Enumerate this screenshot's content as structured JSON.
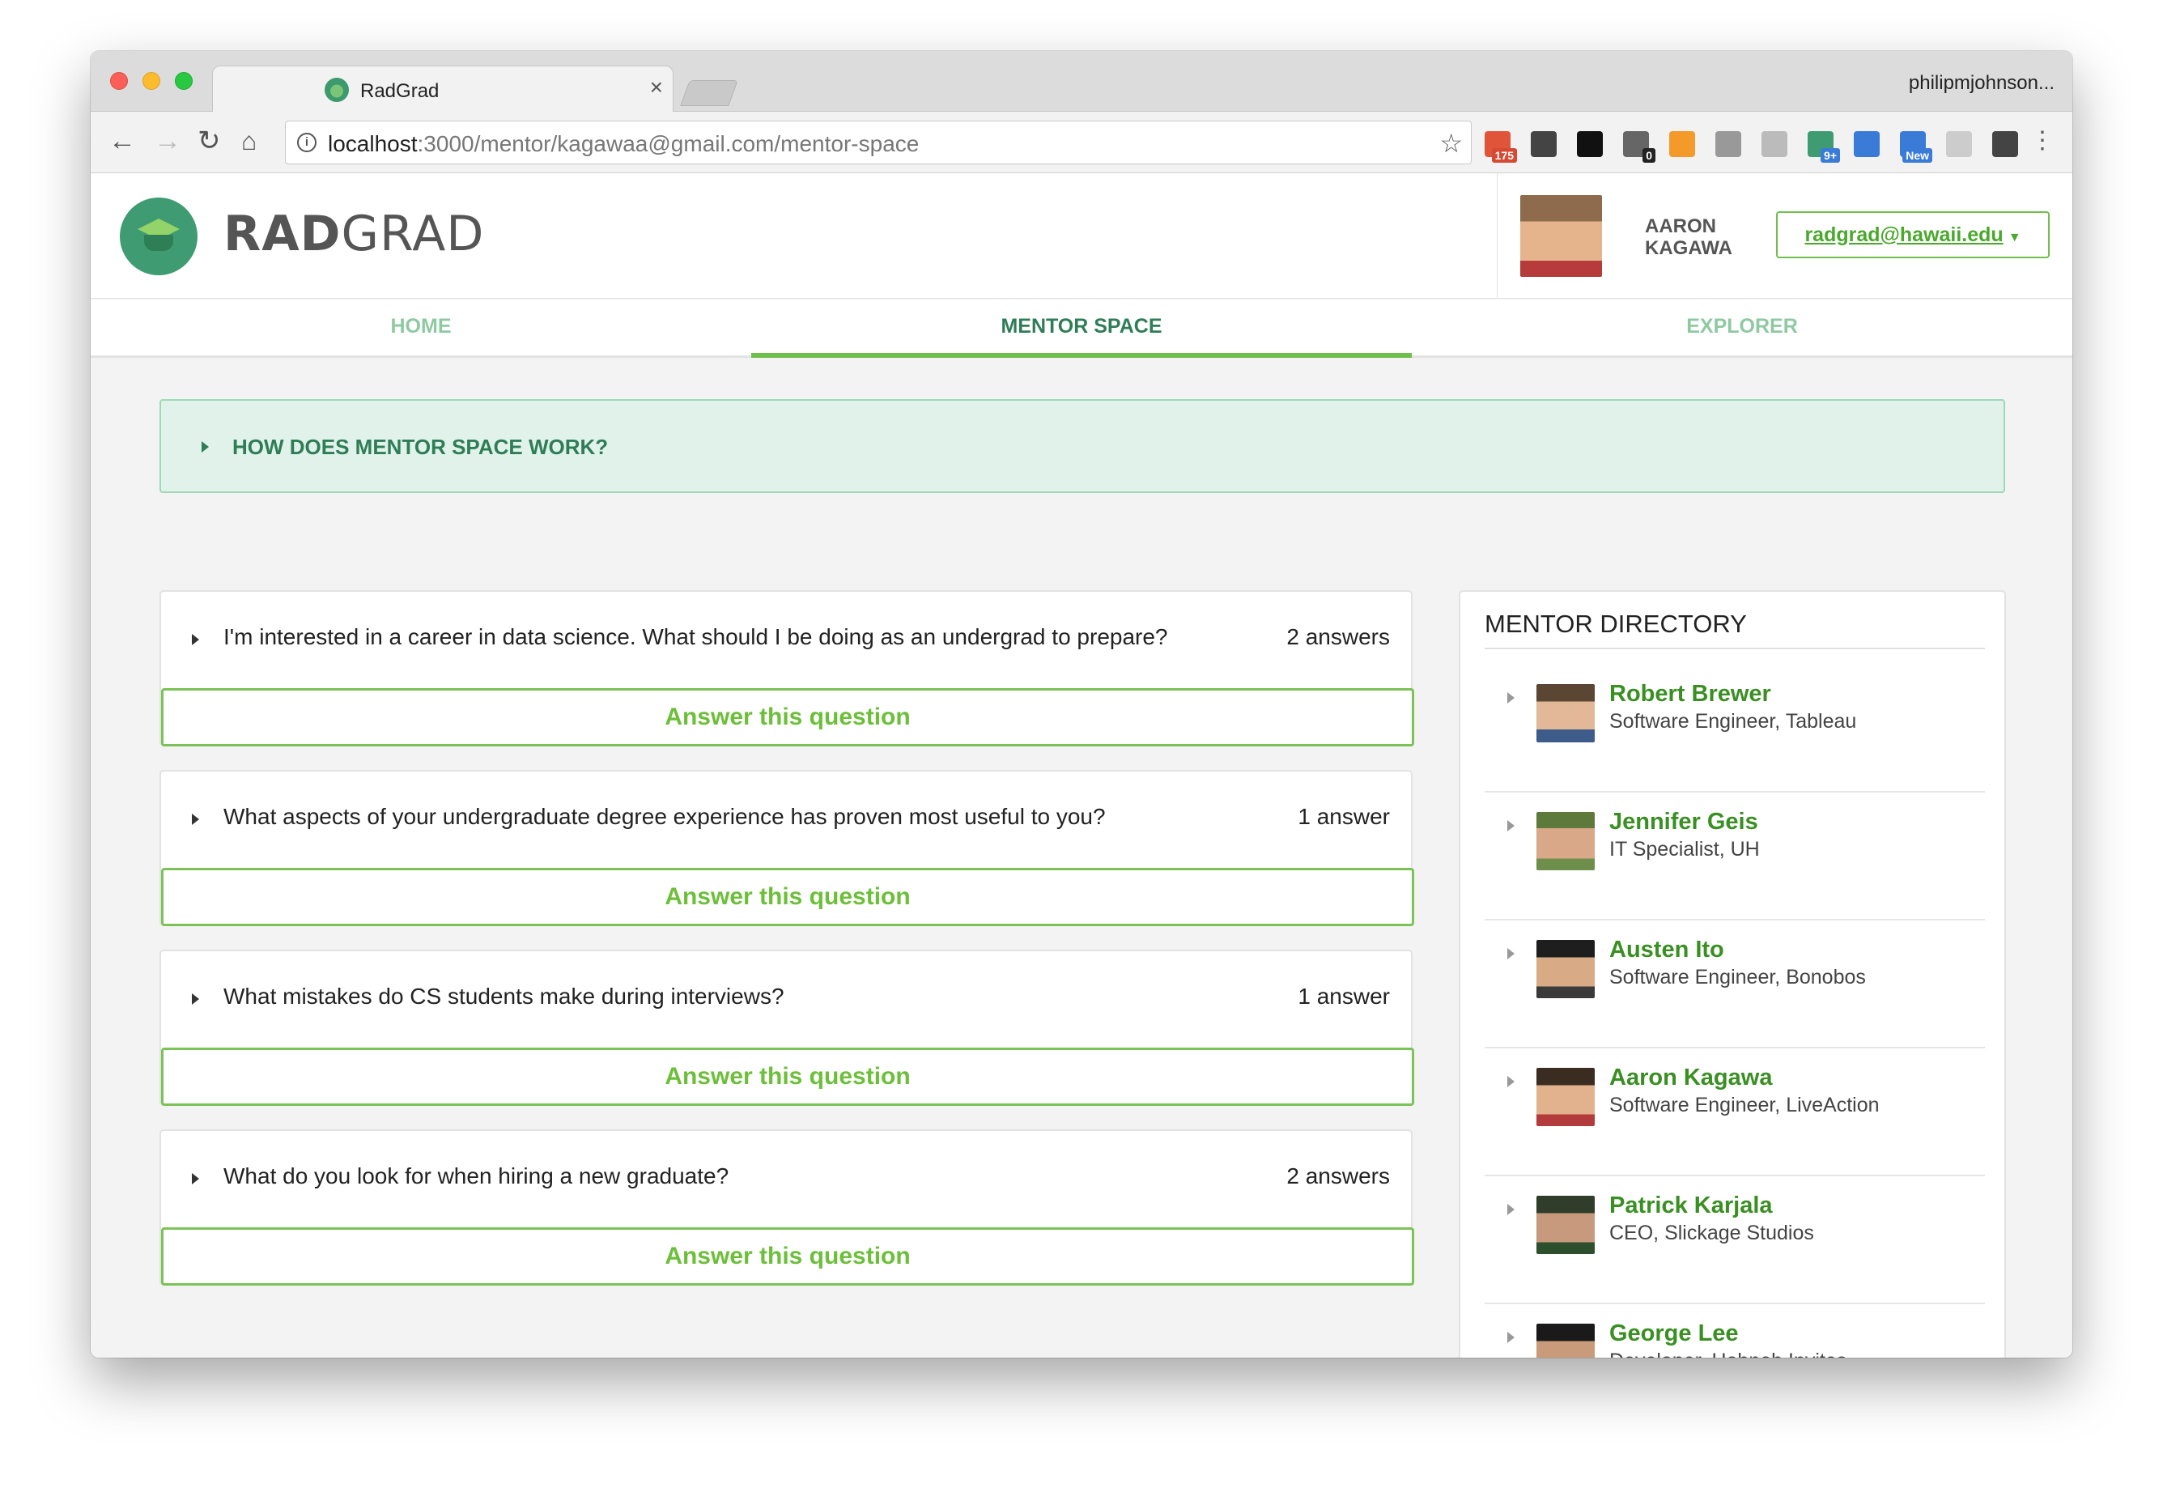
{
  "browser": {
    "tab_title": "RadGrad",
    "tab_close": "×",
    "profile": "philipmjohnson...",
    "url_host": "localhost",
    "url_path": ":3000/mentor/kagawaa@gmail.com/mentor-space",
    "extensions": [
      {
        "icon": "rss-icon",
        "badge": "175",
        "color": "#e0553a"
      },
      {
        "icon": "onepassword-icon",
        "badge": "",
        "color": "#444444"
      },
      {
        "icon": "jetbrains-icon",
        "badge": "",
        "color": "#111111"
      },
      {
        "icon": "lock-icon",
        "badge": "0",
        "color": "#666666"
      },
      {
        "icon": "chart-icon",
        "badge": "",
        "color": "#f39a2b"
      },
      {
        "icon": "camera-icon",
        "badge": "",
        "color": "#999999"
      },
      {
        "icon": "drive-icon",
        "badge": "",
        "color": "#bbbbbb"
      },
      {
        "icon": "hangouts-icon",
        "badge": "9+",
        "color": "#3f9c72"
      },
      {
        "icon": "eyedropper-icon",
        "badge": "",
        "color": "#3b7bd8"
      },
      {
        "icon": "screencast-icon",
        "badge": "New",
        "color": "#3b7bd8"
      },
      {
        "icon": "cookie-icon",
        "badge": "",
        "color": "#cccccc"
      },
      {
        "icon": "sync-icon",
        "badge": "",
        "color": "#444444"
      }
    ]
  },
  "app": {
    "brand_bold": "RAD",
    "brand_light": "GRAD",
    "user_name": "AARON KAGAWA",
    "user_email": "radgrad@hawaii.edu",
    "nav": [
      "HOME",
      "MENTOR SPACE",
      "EXPLORER"
    ],
    "nav_active": "MENTOR SPACE",
    "howto": "HOW DOES MENTOR SPACE WORK?",
    "answer_label": "Answer this question",
    "questions": [
      {
        "text": "I'm interested in a career in data science. What should I be doing as an undergrad to prepare?",
        "count": "2 answers"
      },
      {
        "text": "What aspects of your undergraduate degree experience has proven most useful to you?",
        "count": "1 answer"
      },
      {
        "text": "What mistakes do CS students make during interviews?",
        "count": "1 answer"
      },
      {
        "text": "What do you look for when hiring a new graduate?",
        "count": "2 answers"
      }
    ],
    "directory_title": "MENTOR DIRECTORY",
    "mentors": [
      {
        "name": "Robert Brewer",
        "role": "Software Engineer, Tableau"
      },
      {
        "name": "Jennifer Geis",
        "role": "IT Specialist, UH"
      },
      {
        "name": "Austen Ito",
        "role": "Software Engineer, Bonobos"
      },
      {
        "name": "Aaron Kagawa",
        "role": "Software Engineer, LiveAction"
      },
      {
        "name": "Patrick Karjala",
        "role": "CEO, Slickage Studios"
      },
      {
        "name": "George Lee",
        "role": "Developer, Hobnob Invites"
      }
    ],
    "colors": {
      "accent": "#6fbf4b",
      "dark_green": "#2f7d57",
      "light_panel": "#e0f2ea"
    }
  }
}
